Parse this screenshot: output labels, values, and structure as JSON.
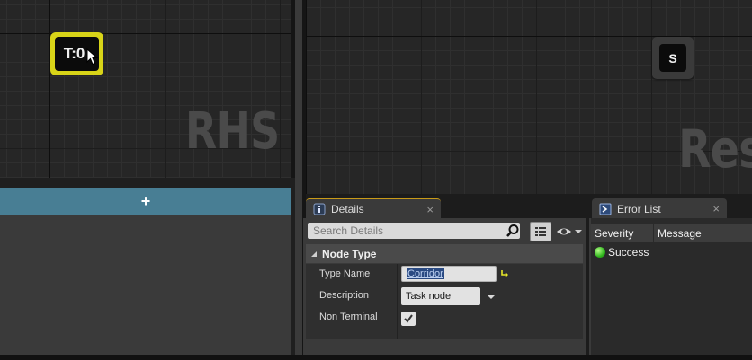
{
  "graph_left": {
    "watermark": "RHS",
    "node_label": "T:0"
  },
  "graph_right": {
    "watermark": "Res",
    "node_label": "S"
  },
  "left_panel": {
    "add_label": "+"
  },
  "details": {
    "tab_label": "Details",
    "tab_icon": "info-icon",
    "close_label": "×",
    "search_placeholder": "Search Details",
    "section_title": "Node Type",
    "properties": {
      "type_name_label": "Type Name",
      "type_name_value": "Corridor",
      "description_label": "Description",
      "description_value": "Task node",
      "non_terminal_label": "Non Terminal",
      "non_terminal_checked": true
    }
  },
  "error_list": {
    "tab_label": "Error List",
    "tab_icon": "console-icon",
    "close_label": "×",
    "columns": [
      "Severity",
      "Message"
    ],
    "rows": [
      {
        "severity": "Success",
        "status_color": "#2fb51c",
        "message": ""
      }
    ]
  },
  "colors": {
    "accent_yellow": "#d8d418",
    "add_bar": "#487e94",
    "tab_highlight": "#c89a18"
  }
}
